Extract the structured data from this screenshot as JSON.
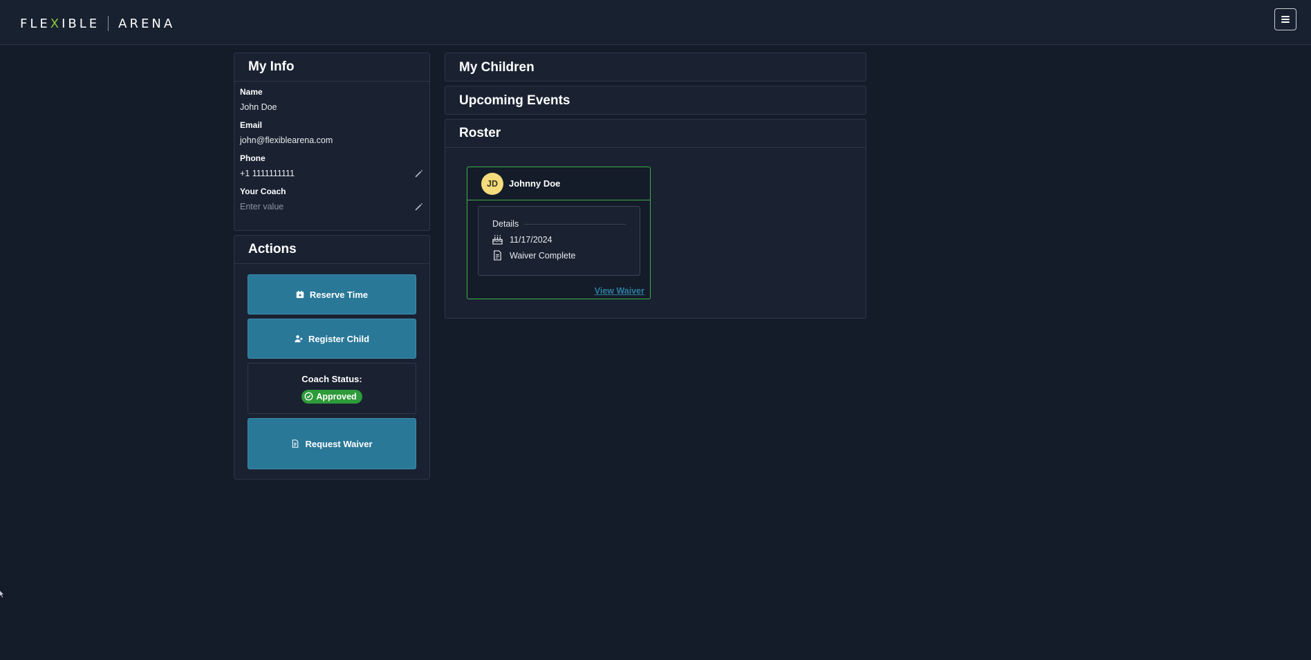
{
  "header": {
    "logo_left": "FLE",
    "logo_x": "X",
    "logo_mid": "IBLE",
    "logo_right": "ARENA",
    "menu_icon": "hamburger-icon"
  },
  "my_info": {
    "title": "My Info",
    "fields": [
      {
        "label": "Name",
        "value": "John Doe"
      },
      {
        "label": "Email",
        "value": "john@flexiblearena.com"
      },
      {
        "label": "Phone",
        "value": "+1 1111111111",
        "icon": "pencil-icon"
      },
      {
        "label": "Your Coach",
        "placeholder": "Enter value",
        "icon": "pencil-icon"
      }
    ]
  },
  "actions": {
    "title": "Actions",
    "reserve_label": "Reserve Time",
    "register_label": "Register Child",
    "coach_status_label": "Coach Status:",
    "coach_status_value": "Approved",
    "request_waiver_label": "Request Waiver"
  },
  "sections": {
    "children_title": "My Children",
    "events_title": "Upcoming Events",
    "roster_title": "Roster"
  },
  "roster": {
    "children": [
      {
        "initials": "JD",
        "name": "Johnny Doe",
        "details_label": "Details",
        "birthday": "11/17/2024",
        "waiver_status": "Waiver Complete",
        "view_waiver_label": "View Waiver"
      }
    ]
  },
  "colors": {
    "background": "#141b29",
    "panel": "#1a2231",
    "button": "#2a7898",
    "accent_green": "#3fb04a",
    "avatar": "#f4db7c"
  }
}
